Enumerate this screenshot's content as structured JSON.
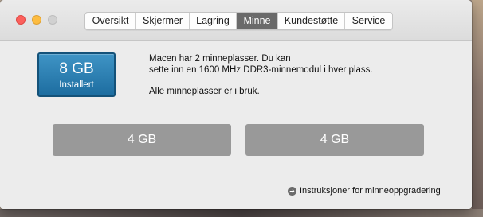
{
  "window": {
    "tabs": [
      {
        "label": "Oversikt",
        "active": false
      },
      {
        "label": "Skjermer",
        "active": false
      },
      {
        "label": "Lagring",
        "active": false
      },
      {
        "label": "Minne",
        "active": true
      },
      {
        "label": "Kundestøtte",
        "active": false
      },
      {
        "label": "Service",
        "active": false
      }
    ]
  },
  "memory": {
    "total": "8 GB",
    "total_label": "Installert",
    "description_line1": "Macen har 2 minneplasser. Du kan",
    "description_line2": "sette inn en 1600 MHz DDR3-minnemodul i hver plass.",
    "status": "Alle minneplasser er i bruk.",
    "slots": [
      "4 GB",
      "4 GB"
    ],
    "upgrade_link": "Instruksjoner for minneoppgradering"
  },
  "colors": {
    "badge": "#2a7fb3",
    "slot": "#999999",
    "active_tab": "#6a6a6a"
  }
}
